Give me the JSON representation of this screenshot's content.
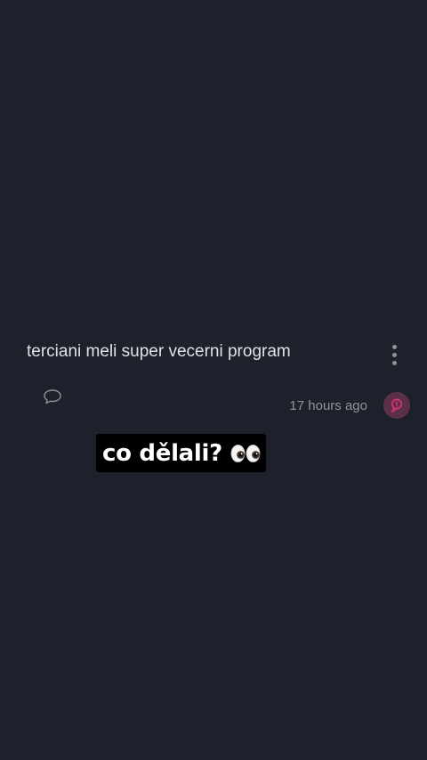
{
  "post": {
    "text": "terciani meli super vecerni program",
    "timestamp": "17 hours ago",
    "caption": "co dělali?",
    "caption_emoji": "👀"
  },
  "icons": {
    "menu": "more-vertical-icon",
    "comment": "comment-bubble-icon",
    "avatar": "user-avatar-icon",
    "emoji": "eyes-emoji-icon"
  },
  "colors": {
    "background": "#1d212b",
    "text": "#dfe1e6",
    "muted": "#8f939b",
    "avatar_bg": "#5c3146",
    "avatar_accent": "#e0307a",
    "caption_bg": "#000000",
    "caption_text": "#ffffff"
  }
}
